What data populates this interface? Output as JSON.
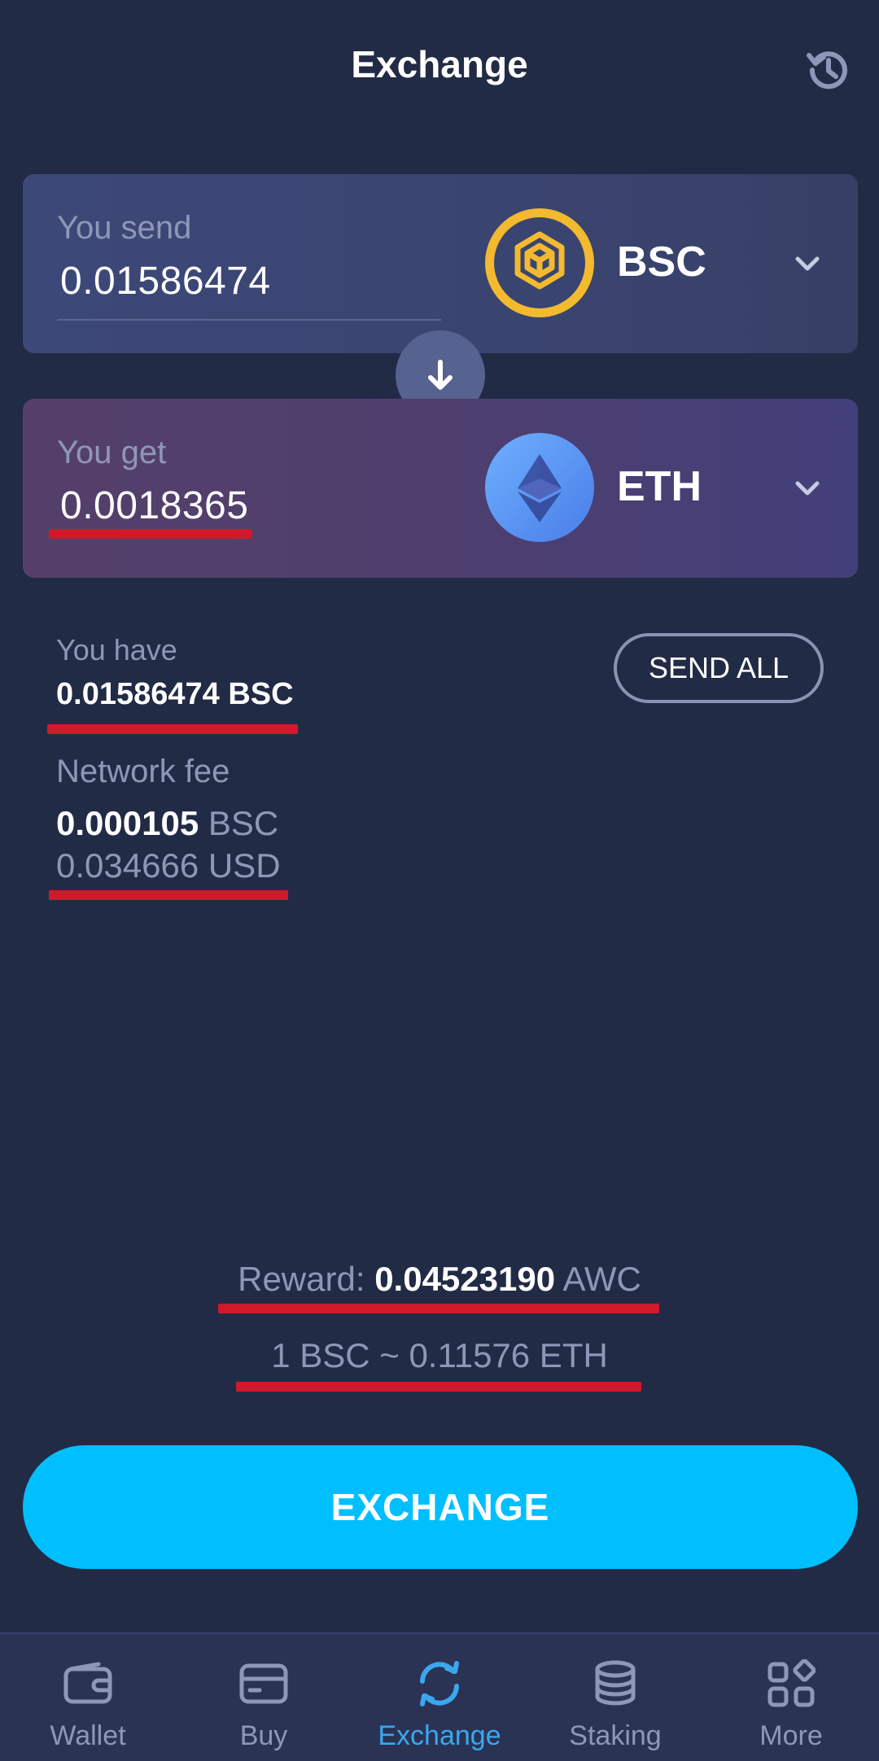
{
  "header": {
    "title": "Exchange",
    "history_icon": "history-icon"
  },
  "send": {
    "label": "You send",
    "value": "0.01586474",
    "coin": "BSC",
    "coin_color": "#f3ba2f"
  },
  "get": {
    "label": "You get",
    "value": "0.0018365",
    "coin": "ETH",
    "coin_color": "#5b8ff0"
  },
  "balance": {
    "label": "You have",
    "value": "0.01586474 BSC",
    "send_all_label": "SEND ALL"
  },
  "fee": {
    "label": "Network fee",
    "amount": "0.000105",
    "amount_unit": "BSC",
    "usd": "0.034666 USD"
  },
  "reward": {
    "label": "Reward:",
    "value": "0.04523190",
    "unit": "AWC"
  },
  "rate": "1 BSC ~ 0.11576 ETH",
  "exchange_button": "EXCHANGE",
  "colors": {
    "background": "#222b45",
    "accent": "#00bfff",
    "active_tab": "#3aa7f0",
    "highlight_underline": "#d0192b"
  },
  "tabs": [
    {
      "label": "Wallet",
      "icon": "wallet-icon",
      "active": false
    },
    {
      "label": "Buy",
      "icon": "card-icon",
      "active": false
    },
    {
      "label": "Exchange",
      "icon": "exchange-icon",
      "active": true
    },
    {
      "label": "Staking",
      "icon": "coins-stack-icon",
      "active": false
    },
    {
      "label": "More",
      "icon": "grid-icon",
      "active": false
    }
  ]
}
